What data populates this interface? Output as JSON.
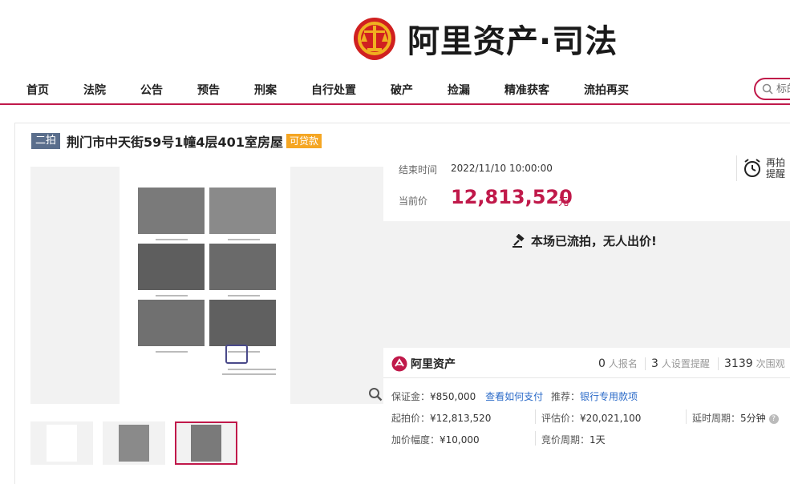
{
  "brand": {
    "name": "阿里资产·司法",
    "emblem_icon": "court-emblem-icon",
    "colors": {
      "accent": "#c0194a",
      "gold": "#f0b020",
      "red": "#d02020"
    }
  },
  "nav": {
    "items": [
      "首页",
      "法院",
      "公告",
      "预告",
      "刑案",
      "自行处置",
      "破产",
      "捡漏",
      "精准获客",
      "流拍再买"
    ],
    "search_placeholder": "标的"
  },
  "listing": {
    "round_tag": "二拍",
    "title": "荆门市中天街59号1幢4层401室房屋",
    "loan_tag": "可贷款"
  },
  "viewer": {
    "thumbnails": [
      {
        "name": "document-thumb",
        "active": false
      },
      {
        "name": "photos-thumb-1",
        "active": false
      },
      {
        "name": "photos-thumb-2",
        "active": true
      }
    ],
    "zoom_icon": "magnify-icon"
  },
  "auction": {
    "end_time_label": "结束时间",
    "end_time": "2022/11/10 10:00:00",
    "price_label": "当前价",
    "price": "12,813,520",
    "price_unit": "元",
    "remind_line1": "再拍",
    "remind_line2": "提醒",
    "status": "本场已流拍，无人出价!"
  },
  "stats": {
    "brand": "阿里资产",
    "signups": "0",
    "signups_label": "人报名",
    "reminders": "3",
    "reminders_label": "人设置提醒",
    "views": "3139",
    "views_label": "次围观"
  },
  "details": {
    "deposit_label": "保证金：",
    "deposit": "¥850,000",
    "deposit_link": "查看如何支付",
    "recommend_label": "推荐：",
    "recommend_link": "银行专用款项",
    "start_price_label": "起拍价：",
    "start_price": "¥12,813,520",
    "appraisal_label": "评估价：",
    "appraisal": "¥20,021,100",
    "delay_label": "延时周期：",
    "delay": "5分钟",
    "increment_label": "加价幅度：",
    "increment": "¥10,000",
    "cycle_label": "竞价周期：",
    "cycle": "1天"
  }
}
